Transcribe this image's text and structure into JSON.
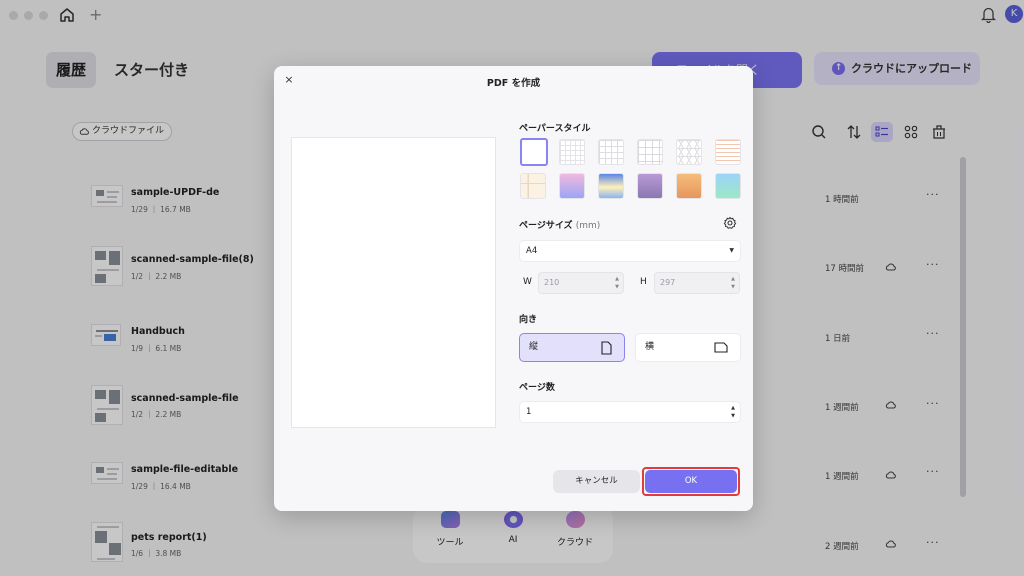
{
  "titlebar": {
    "avatar_initial": "K"
  },
  "tabs": {
    "history": "履歴",
    "starred": "スター付き"
  },
  "header_buttons": {
    "open_label": "ファイルを開く",
    "upload_label": "クラウドにアップロード"
  },
  "cloud_filter": {
    "label": "クラウドファイル"
  },
  "files": [
    {
      "name": "sample-UPDF-de",
      "meta": "1/29 ｜ 16.7 MB",
      "time": "1 時間前",
      "cloud": false
    },
    {
      "name": "scanned-sample-file(8)",
      "meta": "1/2 ｜ 2.2 MB",
      "time": "17 時間前",
      "cloud": true
    },
    {
      "name": "Handbuch",
      "meta": "1/9 ｜ 6.1 MB",
      "time": "1 日前",
      "cloud": false
    },
    {
      "name": "scanned-sample-file",
      "meta": "1/2 ｜ 2.2 MB",
      "time": "1 週間前",
      "cloud": true
    },
    {
      "name": "sample-file-editable",
      "meta": "1/29 ｜ 16.4 MB",
      "time": "1 週間前",
      "cloud": true
    },
    {
      "name": "pets report(1)",
      "meta": "1/6 ｜ 3.8 MB",
      "time": "2 週間前",
      "cloud": true
    }
  ],
  "more_glyph": "···",
  "dock": {
    "tools": "ツール",
    "ai": "AI",
    "cloud": "クラウド"
  },
  "modal": {
    "title": "PDF を作成",
    "close_glyph": "×",
    "paper_style_label": "ペーパースタイル",
    "paper_styles": [
      "blank",
      "small-grid",
      "grid",
      "large-grid",
      "isometric",
      "lined-orange",
      "cornell",
      "gradient-blue-pink",
      "gradient-sky",
      "gradient-purple",
      "gradient-orange",
      "gradient-teal"
    ],
    "page_size_label": "ページサイズ",
    "page_size_unit": "(mm)",
    "page_size_value": "A4",
    "width_label": "W",
    "width_value": "210",
    "height_label": "H",
    "height_value": "297",
    "orientation_label": "向き",
    "orientation_portrait": "縦",
    "orientation_landscape": "横",
    "page_count_label": "ページ数",
    "page_count_value": "1",
    "cancel_label": "キャンセル",
    "ok_label": "OK"
  },
  "colors": {
    "accent": "#7771f2",
    "highlight": "#e23b3b"
  }
}
